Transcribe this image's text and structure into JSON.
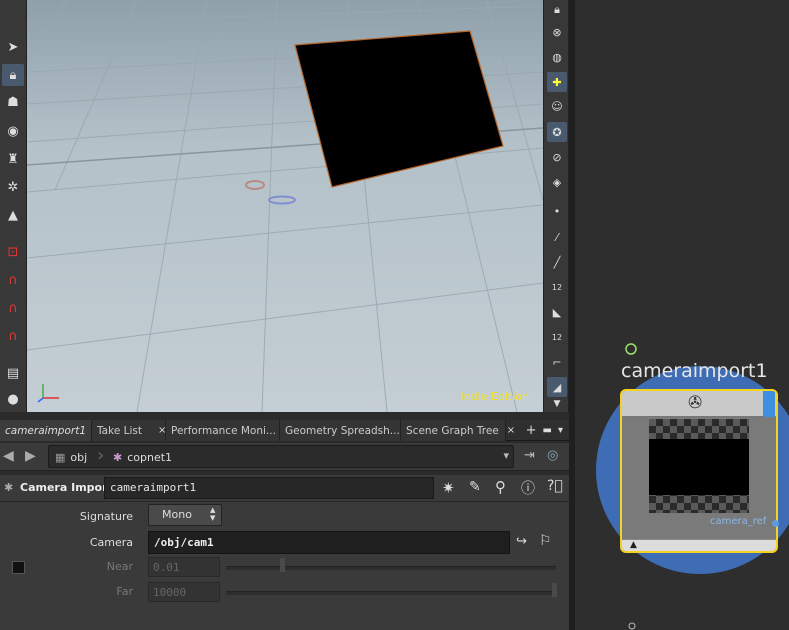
{
  "viewport": {
    "watermark": "Indie Edition"
  },
  "tabs": [
    {
      "label": "cameraimport1",
      "close": "×",
      "active": true
    },
    {
      "label": "Take List",
      "close": "×",
      "active": false
    },
    {
      "label": "Performance Moni...",
      "close": "×",
      "active": false
    },
    {
      "label": "Geometry Spreadsh...",
      "close": "×",
      "active": false
    },
    {
      "label": "Scene Graph Tree",
      "close": "×",
      "active": false
    }
  ],
  "tab_tools": {
    "add": "+",
    "window": "▬",
    "menu": "▾"
  },
  "path": {
    "back": "◀",
    "forward": "▶",
    "crumbs": [
      {
        "label": "obj"
      },
      {
        "label": "copnet1"
      }
    ],
    "dropdown": "▾"
  },
  "param_header": {
    "node_type": "Camera Import",
    "node_name": "cameraimport1"
  },
  "params": {
    "signature_label": "Signature",
    "signature_value": "Mono",
    "signature_arrows": "▲▼",
    "camera_label": "Camera",
    "camera_value": "/obj/cam1",
    "near_label": "Near",
    "near_value": "0.01",
    "far_label": "Far",
    "far_value": "10000"
  },
  "network": {
    "node_name": "cameraimport1",
    "output_label": "camera_ref",
    "flag_up": "▲"
  },
  "colors": {
    "accent_yellow": "#f5d21e",
    "node_ring": "#3e6db5",
    "watermark": "#f2e41f",
    "background": "#2b2b2b"
  },
  "icons": {
    "left_shelf": [
      "select-arrow-icon",
      "lock-icon",
      "pose-icon",
      "camera-handle-icon",
      "paint-icon",
      "skeleton-icon",
      "translate-icon",
      "magnet-drag-icon",
      "magnet-curve-icon",
      "magnet-grab-icon",
      "magnet-icon",
      "clipboard-icon",
      "sphere-icon"
    ],
    "right_shelf": [
      "lock-icon",
      "target-icon",
      "sphere-display-icon",
      "light-bulb-icon",
      "ghost-icon",
      "camera-icon",
      "wire-icon",
      "camera-snapshot-icon",
      "point-icon",
      "pen-icon",
      "needle-icon",
      "num-12-icon",
      "hand-icon",
      "num-12b-icon",
      "angle-icon",
      "quickview-icon"
    ]
  }
}
